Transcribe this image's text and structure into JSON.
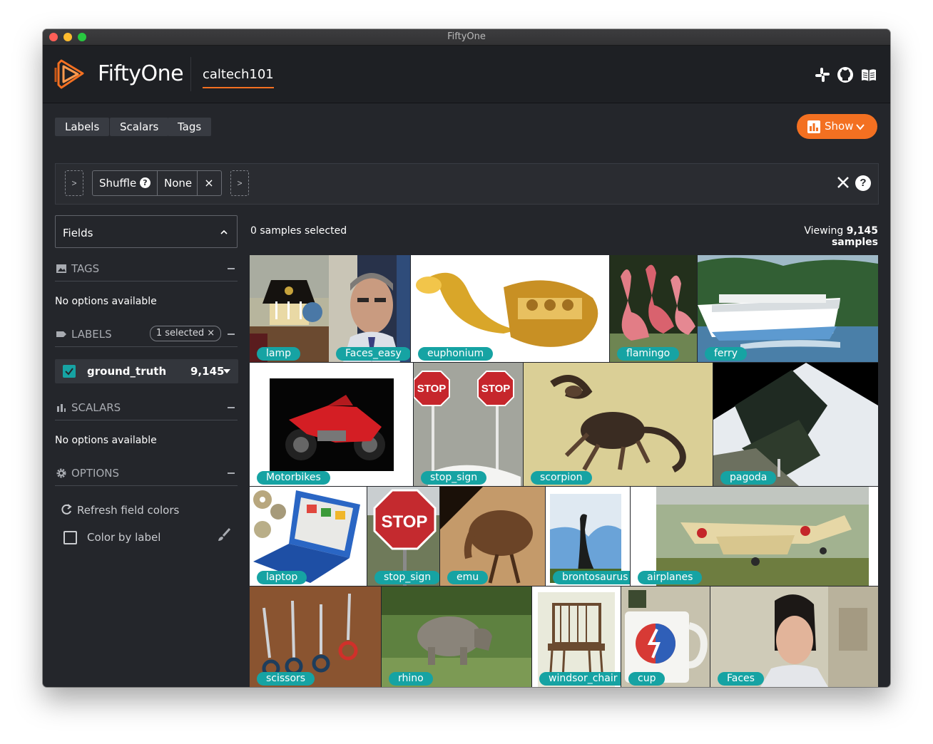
{
  "window": {
    "title": "FiftyOne"
  },
  "header": {
    "brand": "FiftyOne",
    "dataset": "caltech101",
    "icons": [
      "slack-icon",
      "github-icon",
      "docs-book-icon"
    ],
    "accent": "#f37021"
  },
  "toolbar": {
    "tabs": [
      "Labels",
      "Scalars",
      "Tags"
    ],
    "show_label": "Show"
  },
  "stage": {
    "name": "Shuffle",
    "help": "?",
    "value": "None",
    "remove": "×",
    "add_symbol": ">"
  },
  "sidebar": {
    "fields_label": "Fields",
    "tags": {
      "title": "TAGS",
      "empty": "No options available"
    },
    "labels": {
      "title": "LABELS",
      "selected_pill": "1 selected ×",
      "field": {
        "name": "ground_truth",
        "count": "9,145",
        "checked": true,
        "color": "#16a3a3"
      }
    },
    "scalars": {
      "title": "SCALARS",
      "empty": "No options available"
    },
    "options": {
      "title": "OPTIONS",
      "refresh": "Refresh field colors",
      "color_by_label": "Color by label",
      "color_by_label_checked": false
    }
  },
  "main": {
    "selected_text": "0 samples selected",
    "viewing_prefix": "Viewing ",
    "viewing_count": "9,145 samples",
    "samples": [
      {
        "label": "lamp"
      },
      {
        "label": "Faces_easy"
      },
      {
        "label": "euphonium"
      },
      {
        "label": "flamingo"
      },
      {
        "label": "ferry"
      },
      {
        "label": "Motorbikes"
      },
      {
        "label": "stop_sign"
      },
      {
        "label": "scorpion"
      },
      {
        "label": "pagoda"
      },
      {
        "label": "laptop"
      },
      {
        "label": "stop_sign"
      },
      {
        "label": "emu"
      },
      {
        "label": "brontosaurus"
      },
      {
        "label": "airplanes"
      },
      {
        "label": "scissors"
      },
      {
        "label": "rhino"
      },
      {
        "label": "windsor_chair"
      },
      {
        "label": "cup"
      },
      {
        "label": "Faces"
      }
    ],
    "stop_text": "STOP",
    "label_color": "#16a3a3"
  }
}
